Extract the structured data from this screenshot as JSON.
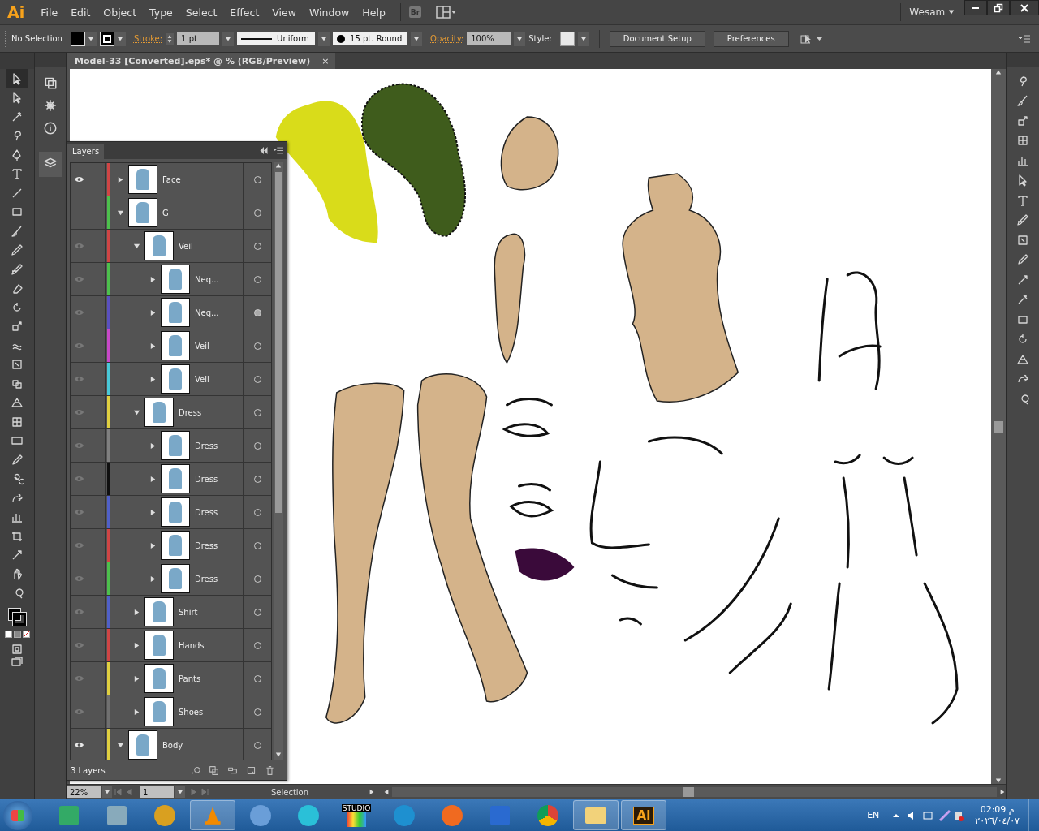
{
  "app": {
    "logo": "Ai",
    "menu": [
      "File",
      "Edit",
      "Object",
      "Type",
      "Select",
      "Effect",
      "View",
      "Window",
      "Help"
    ],
    "bridge_button": "Br",
    "workspace": "Wesam"
  },
  "control_bar": {
    "selection": "No Selection",
    "stroke_label": "Stroke:",
    "stroke_weight": "1 pt",
    "profile": "Uniform",
    "brush": "15 pt. Round",
    "opacity_label": "Opacity:",
    "opacity": "100%",
    "style_label": "Style:",
    "buttons": [
      "Document Setup",
      "Preferences"
    ]
  },
  "document_tab": {
    "title": "Model-33 [Converted].eps* @ % (RGB/Preview)",
    "close": "×"
  },
  "layers_panel": {
    "title": "Layers",
    "footer": "3 Layers",
    "layers": [
      {
        "name": "Face",
        "color": "#d04545",
        "visible": true,
        "eye_hidden": false,
        "expanded": false,
        "targeted": false
      },
      {
        "name": "G",
        "color": "#4cc04c",
        "eye_hidden": true,
        "expanded": true,
        "targeted": false,
        "children": [
          {
            "name": "Veil",
            "color": "#d04545",
            "visible": false,
            "eye_hidden": false,
            "expanded": true,
            "targeted": false,
            "children": [
              {
                "name": "Neq...",
                "color": "#4cc04c",
                "visible": false,
                "eye_hidden": false,
                "expanded": false,
                "targeted": false
              },
              {
                "name": "Neq...",
                "color": "#5a50c0",
                "visible": false,
                "eye_hidden": false,
                "expanded": false,
                "targeted": true
              },
              {
                "name": "Veil",
                "color": "#c848c8",
                "visible": false,
                "eye_hidden": false,
                "expanded": false,
                "targeted": false
              },
              {
                "name": "Veil",
                "color": "#48c8d8",
                "visible": false,
                "eye_hidden": false,
                "expanded": false,
                "targeted": false
              }
            ]
          },
          {
            "name": "Dress",
            "color": "#e0d040",
            "visible": false,
            "eye_hidden": false,
            "expanded": true,
            "targeted": false,
            "children": [
              {
                "name": "Dress",
                "color": "#808080",
                "visible": false,
                "eye_hidden": false,
                "expanded": false,
                "targeted": false
              },
              {
                "name": "Dress",
                "color": "#101010",
                "visible": false,
                "eye_hidden": false,
                "expanded": false,
                "targeted": false
              },
              {
                "name": "Dress",
                "color": "#5060c8",
                "visible": false,
                "eye_hidden": false,
                "expanded": false,
                "targeted": false
              },
              {
                "name": "Dress",
                "color": "#d04545",
                "visible": false,
                "eye_hidden": false,
                "expanded": false,
                "targeted": false
              },
              {
                "name": "Dress",
                "color": "#4cc04c",
                "visible": false,
                "eye_hidden": false,
                "expanded": false,
                "targeted": false
              }
            ]
          },
          {
            "name": "Shirt",
            "color": "#5060c8",
            "visible": false,
            "eye_hidden": false,
            "expanded": false,
            "targeted": false
          },
          {
            "name": "Hands",
            "color": "#d04545",
            "visible": false,
            "eye_hidden": false,
            "expanded": false,
            "targeted": false
          },
          {
            "name": "Pants",
            "color": "#e0d040",
            "visible": false,
            "eye_hidden": false,
            "expanded": false,
            "targeted": false
          },
          {
            "name": "Shoes",
            "color": "#707070",
            "visible": false,
            "eye_hidden": false,
            "expanded": false,
            "targeted": false
          }
        ]
      },
      {
        "name": "Body",
        "color": "#e0d040",
        "visible": true,
        "eye_hidden": false,
        "expanded": true,
        "targeted": false
      }
    ]
  },
  "status_bar": {
    "zoom": "22%",
    "page": "1",
    "tool": "Selection"
  },
  "taskbar": {
    "studio_label": "STUDIO",
    "ai_label": "Ai",
    "language": "EN",
    "time": "02:09 م",
    "date": "٢٠٢٦/٠٤/٠٧"
  }
}
